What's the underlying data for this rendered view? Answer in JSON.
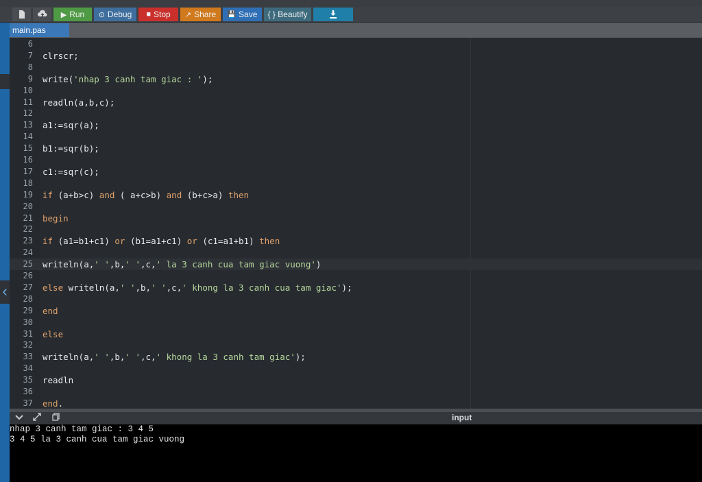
{
  "toolbar": {
    "new_icon": "file-icon",
    "upload_icon": "upload-icon",
    "buttons": [
      {
        "label": "Run",
        "icon": "▶",
        "color": "#4f9a45"
      },
      {
        "label": "Debug",
        "icon": "⊙",
        "color": "#3e6e9e"
      },
      {
        "label": "Stop",
        "icon": "■",
        "color": "#c9302c"
      },
      {
        "label": "Share",
        "icon": "↗",
        "color": "#d07a1d"
      },
      {
        "label": "Save",
        "icon": "💾",
        "color": "#2f6fb6"
      },
      {
        "label": "{ } Beautify",
        "icon": "",
        "color": "#3d6b7d"
      }
    ],
    "download_icon": "download-icon",
    "download_color": "#1f7fa8"
  },
  "tab": {
    "filename": "main.pas"
  },
  "editor": {
    "lines": [
      {
        "n": "6",
        "code": ""
      },
      {
        "n": "7",
        "code": "clrscr;"
      },
      {
        "n": "8",
        "code": ""
      },
      {
        "n": "9",
        "code": "write('nhap 3 canh tam giac : ');"
      },
      {
        "n": "10",
        "code": ""
      },
      {
        "n": "11",
        "code": "readln(a,b,c);"
      },
      {
        "n": "12",
        "code": ""
      },
      {
        "n": "13",
        "code": "a1:=sqr(a);"
      },
      {
        "n": "14",
        "code": ""
      },
      {
        "n": "15",
        "code": "b1:=sqr(b);"
      },
      {
        "n": "16",
        "code": ""
      },
      {
        "n": "17",
        "code": "c1:=sqr(c);"
      },
      {
        "n": "18",
        "code": ""
      },
      {
        "n": "19",
        "code": "if (a+b>c) and ( a+c>b) and (b+c>a) then"
      },
      {
        "n": "20",
        "code": ""
      },
      {
        "n": "21",
        "code": "begin"
      },
      {
        "n": "22",
        "code": ""
      },
      {
        "n": "23",
        "code": "if (a1=b1+c1) or (b1=a1+c1) or (c1=a1+b1) then"
      },
      {
        "n": "24",
        "code": ""
      },
      {
        "n": "25",
        "code": "writeln(a,' ',b,' ',c,' la 3 canh cua tam giac vuong')"
      },
      {
        "n": "26",
        "code": ""
      },
      {
        "n": "27",
        "code": "else writeln(a,' ',b,' ',c,' khong la 3 canh cua tam giac');"
      },
      {
        "n": "28",
        "code": ""
      },
      {
        "n": "29",
        "code": "end"
      },
      {
        "n": "30",
        "code": ""
      },
      {
        "n": "31",
        "code": "else"
      },
      {
        "n": "32",
        "code": ""
      },
      {
        "n": "33",
        "code": "writeln(a,' ',b,' ',c,' khong la 3 canh tam giac');"
      },
      {
        "n": "34",
        "code": ""
      },
      {
        "n": "35",
        "code": "readln"
      },
      {
        "n": "36",
        "code": ""
      },
      {
        "n": "37",
        "code": "end."
      }
    ],
    "highlighted_line": "25"
  },
  "output": {
    "title": "input",
    "icons": [
      "chevron-down-icon",
      "expand-icon",
      "copy-icon"
    ],
    "lines": [
      "nhap 3 canh tam giac : 3 4 5",
      "3 4 5 la 3 canh cua tam giac vuong"
    ]
  }
}
